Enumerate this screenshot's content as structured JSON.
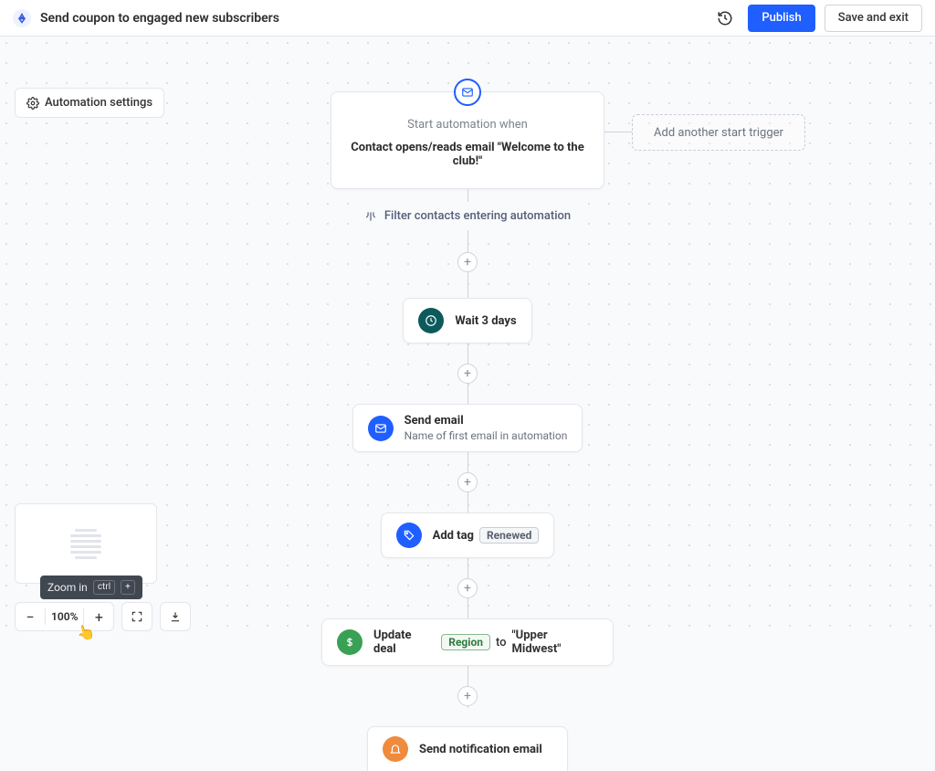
{
  "header": {
    "title": "Send coupon to engaged new subscribers",
    "publish": "Publish",
    "save_exit": "Save and exit"
  },
  "automation_settings": "Automation settings",
  "trigger": {
    "subtitle": "Start automation when",
    "headline": "Contact opens/reads email \"Welcome to the club!\""
  },
  "add_trigger": "Add another start trigger",
  "filter_label": "Filter contacts entering automation",
  "nodes": {
    "wait": {
      "label": "Wait 3 days"
    },
    "email": {
      "title": "Send email",
      "sub": "Name of first email in automation"
    },
    "tag": {
      "title": "Add tag",
      "tag": "Renewed"
    },
    "deal": {
      "title": "Update deal",
      "field": "Region",
      "mid": "to",
      "value": "\"Upper Midwest\""
    },
    "notify": {
      "title": "Send notification email"
    }
  },
  "tooltip": {
    "label": "Zoom in",
    "k1": "ctrl",
    "k2": "+"
  },
  "zoom": {
    "level": "100%"
  }
}
